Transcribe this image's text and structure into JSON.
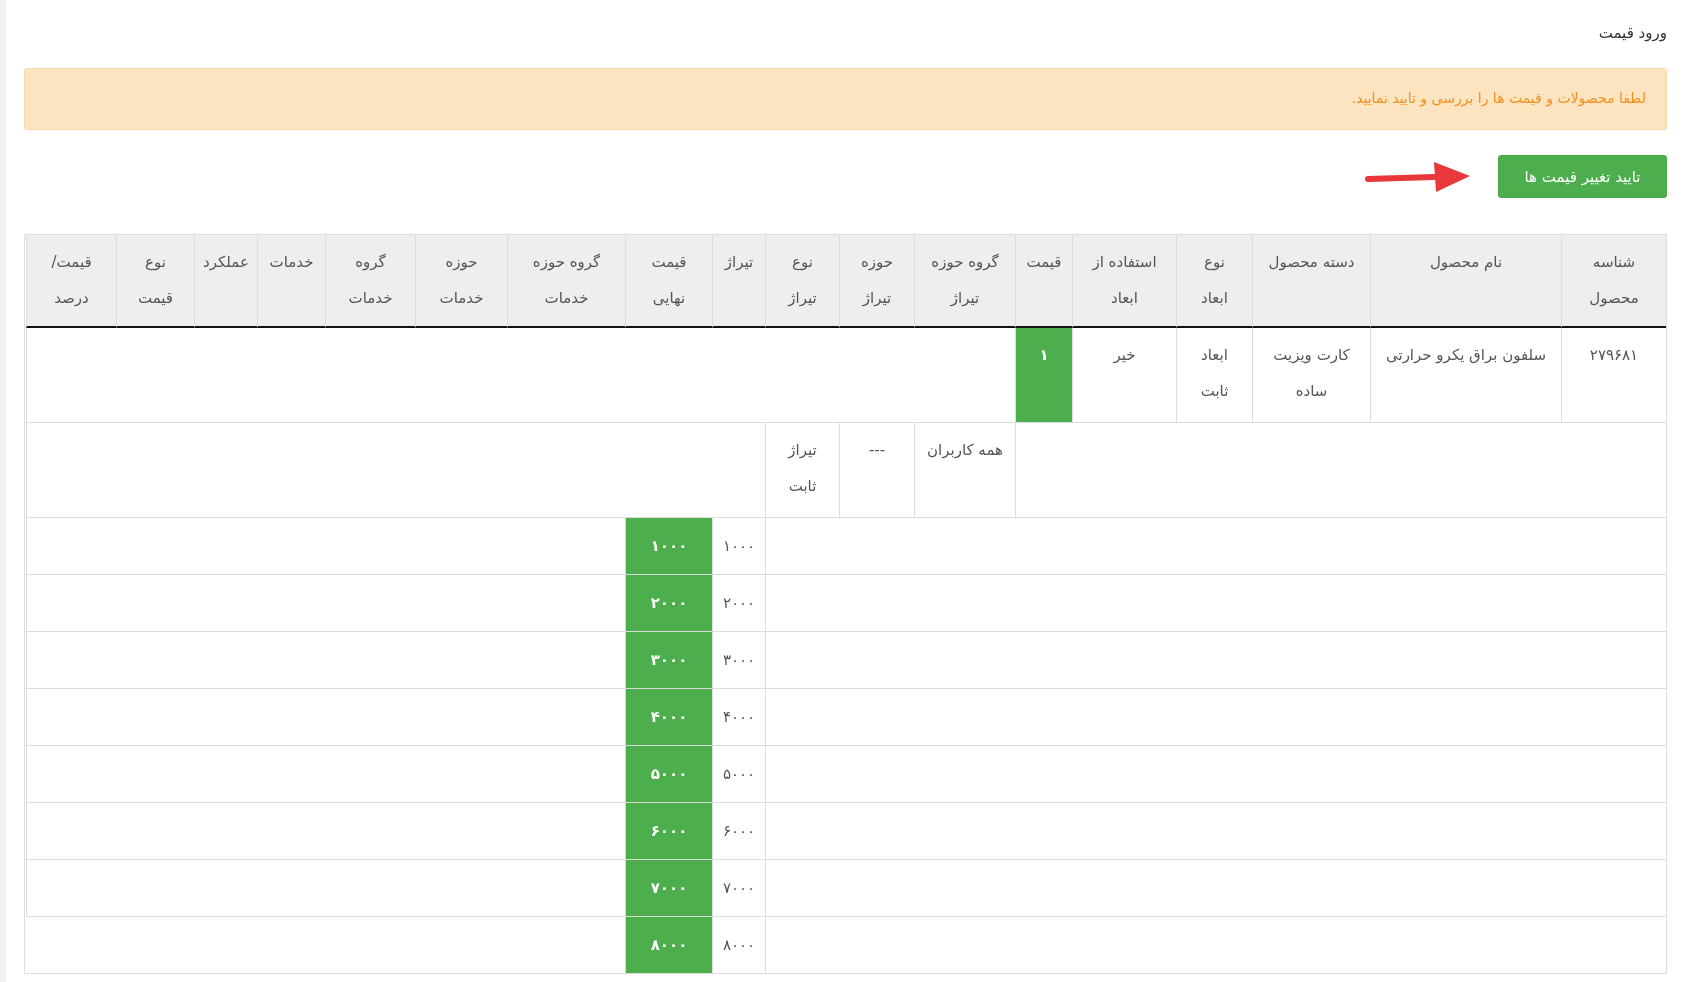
{
  "page_title": "ورود قیمت",
  "alert": "لطفا محصولات و قیمت ها را بررسی و تایید نمایید.",
  "confirm_button": "تایید تغییر قیمت ها",
  "table": {
    "columns": [
      "شناسه\nمحصول",
      "نام محصول",
      "دسته محصول",
      "نوع\nابعاد",
      "استفاده از\nابعاد",
      "قیمت",
      "گروه حوزه\nتیراژ",
      "حوزه\nتیراژ",
      "نوع\nتیراژ",
      "تیراژ",
      "قیمت\nنهایی",
      "گروه حوزه\nخدمات",
      "حوزه\nخدمات",
      "گروه\nخدمات",
      "خدمات",
      "عملکرد",
      "نوع\nقیمت",
      "قیمت/\nدرصد"
    ],
    "product": {
      "id": "۲۷۹۶۸۱",
      "name": "سلفون براق یکرو حرارتی",
      "category": "کارت ویزیت\nساده",
      "dimension_type": "ابعاد\nثابت",
      "use_dimensions": "خیر",
      "price": "۱"
    },
    "circulation_group": {
      "group": "همه کاربران",
      "area": "---",
      "type": "تیراژ\nثابت"
    },
    "tiers": [
      {
        "circulation": "۱۰۰۰",
        "final_price": "۱۰۰۰"
      },
      {
        "circulation": "۲۰۰۰",
        "final_price": "۲۰۰۰"
      },
      {
        "circulation": "۳۰۰۰",
        "final_price": "۳۰۰۰"
      },
      {
        "circulation": "۴۰۰۰",
        "final_price": "۴۰۰۰"
      },
      {
        "circulation": "۵۰۰۰",
        "final_price": "۵۰۰۰"
      },
      {
        "circulation": "۶۰۰۰",
        "final_price": "۶۰۰۰"
      },
      {
        "circulation": "۷۰۰۰",
        "final_price": "۷۰۰۰"
      },
      {
        "circulation": "۸۰۰۰",
        "final_price": "۸۰۰۰"
      }
    ]
  }
}
